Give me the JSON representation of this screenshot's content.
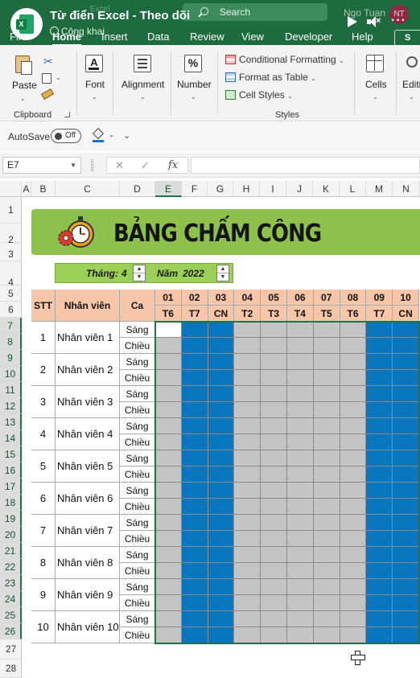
{
  "titlebar": {
    "title": "Từ điển Excel - Theo dõi",
    "public_label": "Công khai",
    "search_placeholder": "Search",
    "ghost_filename": "Excel",
    "user_name": "Ngo Tuan",
    "user_initials": "NT"
  },
  "tabs": [
    "File",
    "Home",
    "Insert",
    "Data",
    "Review",
    "View",
    "Developer",
    "Help"
  ],
  "share_label": "S",
  "ribbon": {
    "paste": "Paste",
    "clipboard": "Clipboard",
    "font": "Font",
    "alignment": "Alignment",
    "number": "Number",
    "number_symbol": "%",
    "conditional_formatting": "Conditional Formatting",
    "format_as_table": "Format as Table",
    "cell_styles": "Cell Styles",
    "styles": "Styles",
    "cells": "Cells",
    "editing": "Editi"
  },
  "qat": {
    "autosave": "AutoSave",
    "toggle": "Off"
  },
  "formula": {
    "namebox": "E7",
    "cancel": "✕",
    "enter": "✓",
    "fx": "fx",
    "value": ""
  },
  "columns": [
    "A",
    "B",
    "C",
    "D",
    "E",
    "F",
    "G",
    "H",
    "I",
    "J",
    "K",
    "L",
    "M",
    "N"
  ],
  "selected_column": "E",
  "selected_rows": [
    7,
    8,
    9,
    10,
    11,
    12,
    13,
    14,
    15,
    16,
    17,
    18,
    19,
    20,
    21,
    22,
    23,
    24,
    25,
    26
  ],
  "sheet": {
    "title": "BẢNG CHẤM CÔNG",
    "month_label": "Tháng:",
    "month": "4",
    "year_label": "Năm",
    "year": "2022",
    "headers": {
      "stt": "STT",
      "employee": "Nhân viên",
      "shift": "Ca"
    },
    "days": [
      "01",
      "02",
      "03",
      "04",
      "05",
      "06",
      "07",
      "08",
      "09",
      "10"
    ],
    "weekdays": [
      "T6",
      "T7",
      "CN",
      "T2",
      "T3",
      "T4",
      "T5",
      "T6",
      "T7",
      "CN"
    ],
    "weekend_days": [
      "02",
      "03",
      "09",
      "10"
    ],
    "shifts": [
      "Sáng",
      "Chiều"
    ],
    "employees": [
      {
        "stt": "1",
        "name": "Nhân viên 1"
      },
      {
        "stt": "2",
        "name": "Nhân viên 2"
      },
      {
        "stt": "3",
        "name": "Nhân viên 3"
      },
      {
        "stt": "4",
        "name": "Nhân viên 4"
      },
      {
        "stt": "5",
        "name": "Nhân viên 5"
      },
      {
        "stt": "6",
        "name": "Nhân viên 6"
      },
      {
        "stt": "7",
        "name": "Nhân viên 7"
      },
      {
        "stt": "8",
        "name": "Nhân viên 8"
      },
      {
        "stt": "9",
        "name": "Nhân viên 9"
      },
      {
        "stt": "10",
        "name": "Nhân viên 10"
      }
    ]
  },
  "colors": {
    "titlebar": "#1e6b40",
    "banner": "#8dc14b",
    "period": "#9bcf57",
    "header_fill": "#f7c5a8",
    "weekend_fill": "#0a76bd",
    "weekday_fill": "#c4c4c4",
    "selection": "#217346"
  }
}
